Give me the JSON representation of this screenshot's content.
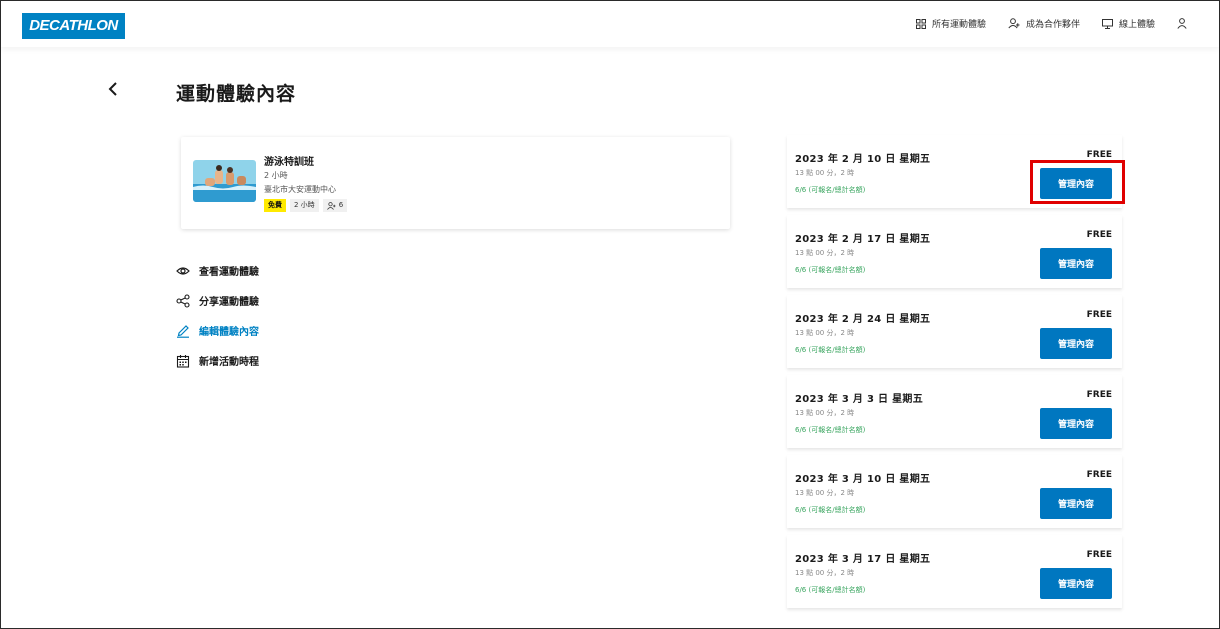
{
  "header": {
    "logo": "DECATHLON",
    "nav": [
      {
        "label": "所有運動體驗",
        "icon": "grid-icon"
      },
      {
        "label": "成為合作夥伴",
        "icon": "partner-icon"
      },
      {
        "label": "線上體驗",
        "icon": "monitor-icon"
      }
    ],
    "user_icon": "user-icon"
  },
  "page": {
    "title": "運動體驗內容"
  },
  "course": {
    "name": "游泳特訓班",
    "duration": "2 小時",
    "location": "臺北市大安運動中心",
    "tags": {
      "free": "免費",
      "duration": "2 小時",
      "capacity": "6"
    }
  },
  "actions": [
    {
      "label": "查看運動體驗",
      "icon": "eye-icon"
    },
    {
      "label": "分享運動體驗",
      "icon": "share-icon"
    },
    {
      "label": "編輯體驗內容",
      "icon": "pencil-icon"
    },
    {
      "label": "新增活動時程",
      "icon": "calendar-icon"
    }
  ],
  "sessions": [
    {
      "date": "2023 年 2 月 10 日 星期五",
      "time": "13 點 00 分，2 時",
      "seats": "6/6 (可報名/總計名額)",
      "price": "FREE",
      "button": "管理內容"
    },
    {
      "date": "2023 年 2 月 17 日 星期五",
      "time": "13 點 00 分，2 時",
      "seats": "6/6 (可報名/總計名額)",
      "price": "FREE",
      "button": "管理內容"
    },
    {
      "date": "2023 年 2 月 24 日 星期五",
      "time": "13 點 00 分，2 時",
      "seats": "6/6 (可報名/總計名額)",
      "price": "FREE",
      "button": "管理內容"
    },
    {
      "date": "2023 年 3 月 3 日 星期五",
      "time": "13 點 00 分，2 時",
      "seats": "6/6 (可報名/總計名額)",
      "price": "FREE",
      "button": "管理內容"
    },
    {
      "date": "2023 年 3 月 10 日 星期五",
      "time": "13 點 00 分，2 時",
      "seats": "6/6 (可報名/總計名額)",
      "price": "FREE",
      "button": "管理內容"
    },
    {
      "date": "2023 年 3 月 17 日 星期五",
      "time": "13 點 00 分，2 時",
      "seats": "6/6 (可報名/總計名額)",
      "price": "FREE",
      "button": "管理內容"
    }
  ],
  "colors": {
    "brand": "#0082c3",
    "button": "#0077c0",
    "free_tag": "#ffea00",
    "seats_text": "#3aa660",
    "highlight": "#e00000"
  }
}
